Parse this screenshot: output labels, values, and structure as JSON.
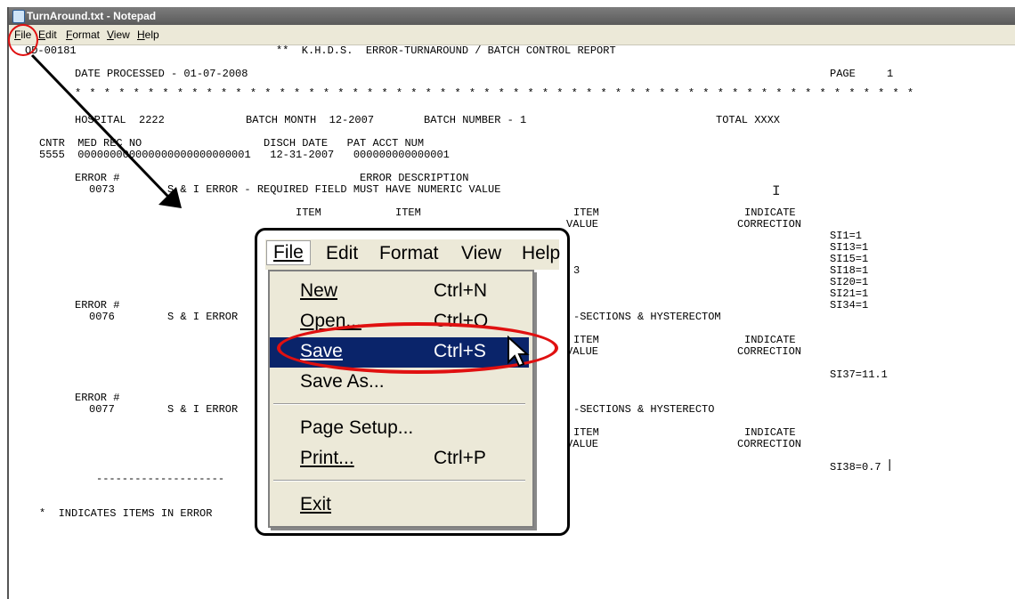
{
  "window": {
    "title": "TurnAround.txt - Notepad"
  },
  "menubar": {
    "items": [
      "File",
      "Edit",
      "Format",
      "View",
      "Help"
    ]
  },
  "report": {
    "id": "OD-00181",
    "header": "**  K.H.D.S.  ERROR-TURNAROUND / BATCH CONTROL REPORT",
    "date_processed": "DATE PROCESSED - 01-07-2008",
    "page_label": "PAGE",
    "page_number": "1",
    "stars": "* * * * * * * * * * * * * * * * * * * * * * * * * * * * * * * * * * * * * * * * * * * * * * * * * * * * * * * * * *",
    "hospital": "HOSPITAL  2222",
    "batch_month": "BATCH MONTH  12-2007",
    "batch_number": "BATCH NUMBER - 1",
    "total": "TOTAL XXXX",
    "col_header": "CNTR  MED REC NO                   DISCH DATE   PAT ACCT NUM",
    "col_values": "5555  000000000000000000000000001   12-31-2007   000000000000001",
    "errors": [
      {
        "label": "ERROR #",
        "code": "0073",
        "description_header": "ERROR DESCRIPTION",
        "description": "S & I ERROR - REQUIRED FIELD MUST HAVE NUMERIC VALUE",
        "item1": "ITEM",
        "item2": "ITEM",
        "item3": "ITEM",
        "value": "VALUE",
        "indicate": "INDICATE",
        "correction": "CORRECTION",
        "value_fragment": "3",
        "corrections": [
          "SI1=1",
          "SI13=1",
          "SI15=1",
          "SI18=1",
          "SI20=1",
          "SI21=1",
          "SI34=1"
        ]
      },
      {
        "label": "ERROR #",
        "code": "0076",
        "description": "S & I ERROR",
        "description_tail": "-SECTIONS & HYSTERECTOM",
        "item3": "ITEM",
        "value": "VALUE",
        "indicate": "INDICATE",
        "correction": "CORRECTION",
        "corrections": [
          "SI37=11.1"
        ]
      },
      {
        "label": "ERROR #",
        "code": "0077",
        "description": "S & I ERROR",
        "description_tail": "-SECTIONS & HYSTERECTO",
        "item3": "ITEM",
        "value": "VALUE",
        "indicate": "INDICATE",
        "correction": "CORRECTION",
        "corrections": [
          "SI38=0.7"
        ]
      }
    ],
    "dashes": "--------------------",
    "footnote": "*  INDICATES ITEMS IN ERROR"
  },
  "callout": {
    "menus": [
      "File",
      "Edit",
      "Format",
      "View",
      "Help"
    ],
    "file_menu": [
      {
        "label": "New",
        "shortcut": "Ctrl+N"
      },
      {
        "label": "Open...",
        "shortcut": "Ctrl+O"
      },
      {
        "label": "Save",
        "shortcut": "Ctrl+S"
      },
      {
        "label": "Save As...",
        "shortcut": ""
      },
      {
        "label": "Page Setup...",
        "shortcut": ""
      },
      {
        "label": "Print...",
        "shortcut": "Ctrl+P"
      },
      {
        "label": "Exit",
        "shortcut": ""
      }
    ]
  },
  "colors": {
    "highlight": "#0a246a",
    "annotation": "#e01010",
    "menu_bg": "#ece9d8"
  }
}
